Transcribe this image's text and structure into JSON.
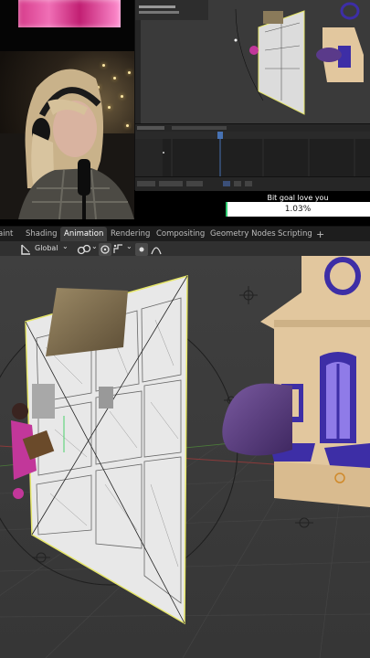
{
  "stream": {
    "goal_title": "Bit goal love you",
    "goal_percent": "1.03%",
    "goal_fraction": 0.0103,
    "goal_color": "#2ecc71"
  },
  "workspaces": [
    {
      "label": "aint"
    },
    {
      "label": "Shading"
    },
    {
      "label": "Animation"
    },
    {
      "label": "Rendering"
    },
    {
      "label": "Compositing"
    },
    {
      "label": "Geometry Nodes"
    },
    {
      "label": "Scripting"
    },
    {
      "label": "+"
    }
  ],
  "viewport_header": {
    "orientation_label": "Global"
  },
  "colors": {
    "selection_outline": "#e6e66a",
    "accent_active": "#4772b3",
    "house_body": "#e2c79e",
    "house_trim": "#3d2ea6"
  },
  "icons": [
    "transform-icon",
    "link-icon",
    "snap-icon",
    "proportional-icon",
    "falloff-icon"
  ]
}
